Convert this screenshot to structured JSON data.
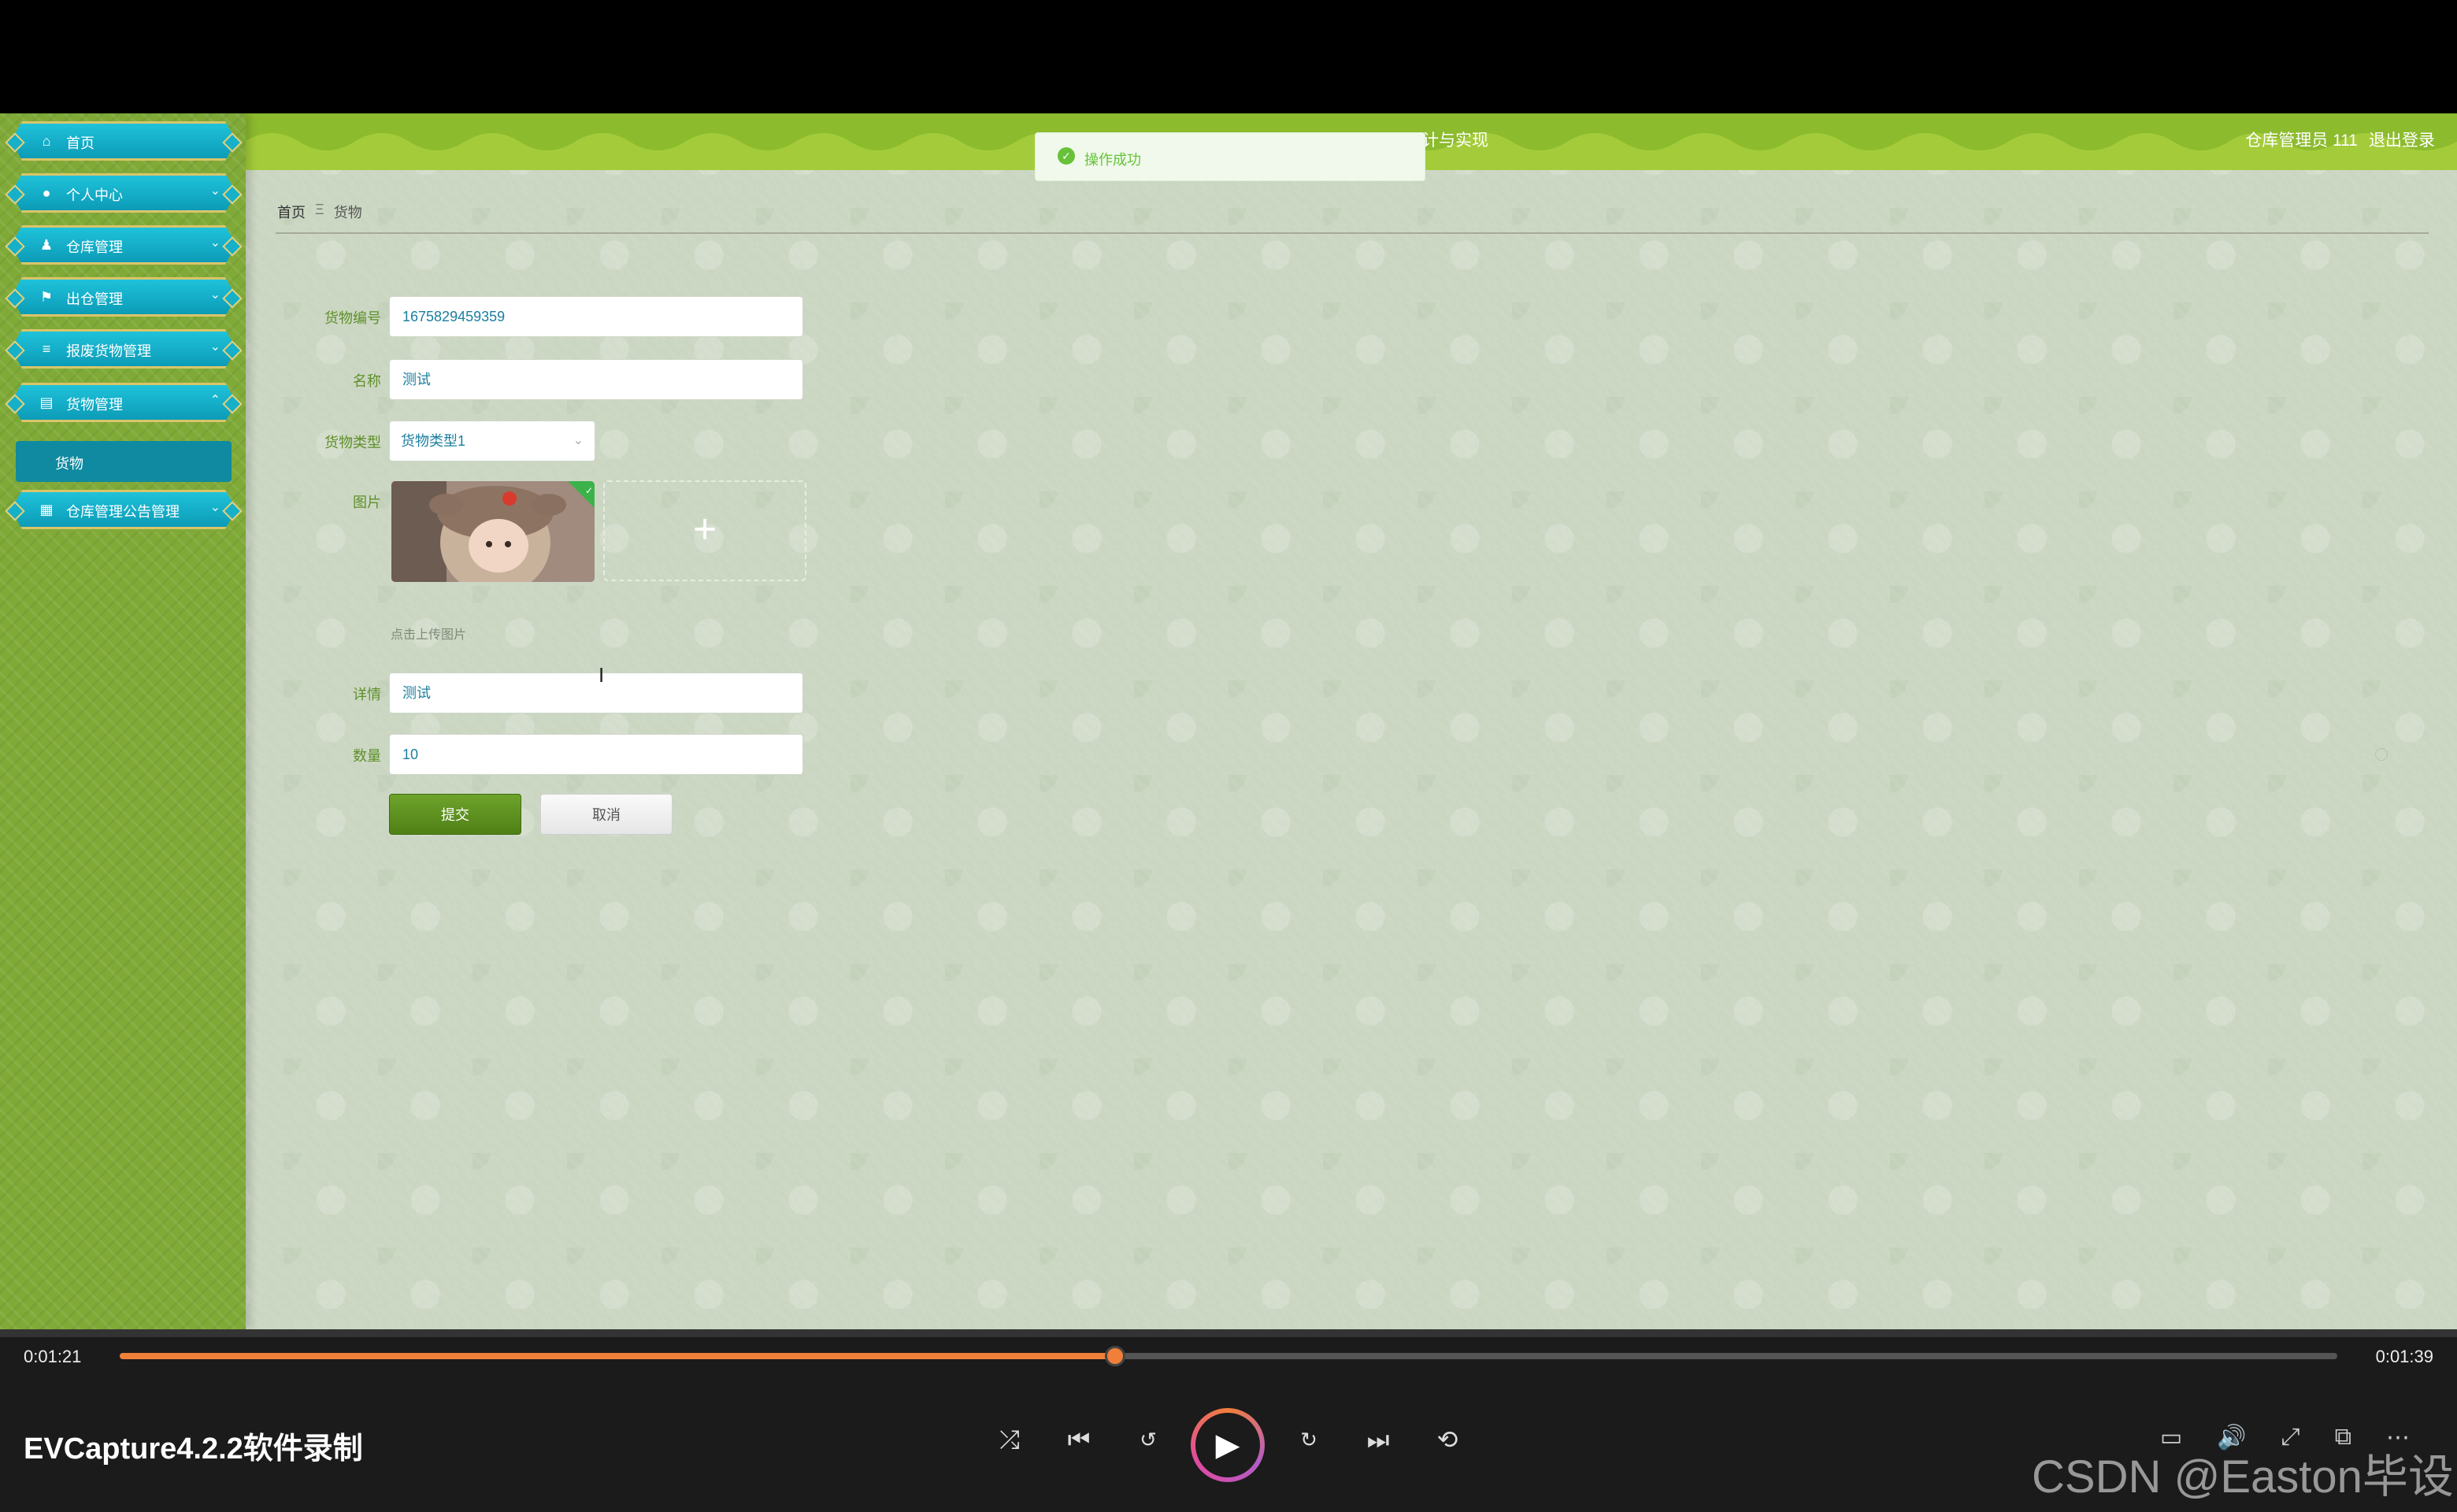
{
  "header": {
    "title_fragment": "计与实现",
    "user": "仓库管理员 111",
    "logout": "退出登录"
  },
  "toast": {
    "message": "操作成功"
  },
  "sidebar": {
    "items": [
      {
        "label": "首页",
        "icon": "home-icon",
        "has_chevron": false
      },
      {
        "label": "个人中心",
        "icon": "user-icon",
        "has_chevron": true
      },
      {
        "label": "仓库管理",
        "icon": "warehouse-user-icon",
        "has_chevron": true
      },
      {
        "label": "出仓管理",
        "icon": "flag-icon",
        "has_chevron": true
      },
      {
        "label": "报废货物管理",
        "icon": "list-icon",
        "has_chevron": true
      },
      {
        "label": "货物管理",
        "icon": "clipboard-icon",
        "has_chevron": true,
        "expanded": true
      },
      {
        "label": "仓库管理公告管理",
        "icon": "grid-icon",
        "has_chevron": true
      }
    ],
    "submenu": {
      "label": "货物"
    }
  },
  "breadcrumb": {
    "home": "首页",
    "separator": "Ξ",
    "current": "货物"
  },
  "form": {
    "code_label": "货物编号",
    "code_value": "1675829459359",
    "name_label": "名称",
    "name_value": "测试",
    "type_label": "货物类型",
    "type_value": "货物类型1",
    "image_label": "图片",
    "upload_hint": "点击上传图片",
    "detail_label": "详情",
    "detail_value": "测试",
    "qty_label": "数量",
    "qty_value": "10",
    "submit": "提交",
    "cancel": "取消"
  },
  "player": {
    "elapsed": "0:01:21",
    "total": "0:01:39",
    "progress_fraction": 0.449,
    "recorder_label": "EVCapture4.2.2软件录制",
    "watermark": "CSDN @Easton毕设"
  },
  "colors": {
    "header": "#8cbb2e",
    "menu": "#12acc6",
    "progress": "#f07f3a",
    "toast_text": "#67c23a"
  }
}
